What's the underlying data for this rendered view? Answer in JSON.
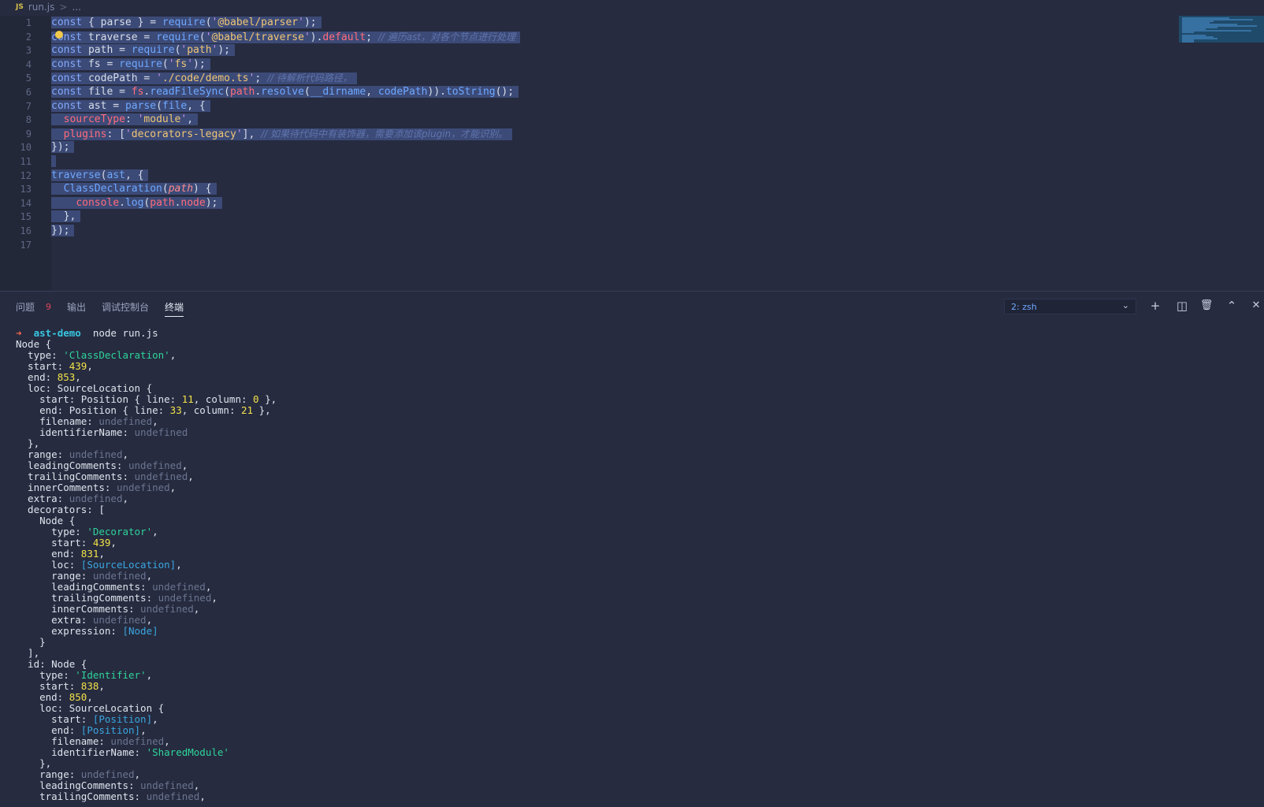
{
  "breadcrumb": {
    "badge": "JS",
    "file": "run.js",
    "sep": ">",
    "more": "..."
  },
  "editor": {
    "line_numbers": [
      "1",
      "2",
      "3",
      "4",
      "5",
      "6",
      "7",
      "8",
      "9",
      "10",
      "11",
      "12",
      "13",
      "14",
      "15",
      "16",
      "17"
    ],
    "lines": [
      [
        [
          "kw",
          "const "
        ],
        [
          "punc",
          "{ "
        ],
        [
          "id",
          "parse"
        ],
        [
          "punc",
          " } = "
        ],
        [
          "fn",
          "require"
        ],
        [
          "punc",
          "("
        ],
        [
          "strq",
          "'"
        ],
        [
          "str",
          "@babel/parser"
        ],
        [
          "strq",
          "'"
        ],
        [
          "punc",
          ");"
        ]
      ],
      [
        [
          "kw",
          "const "
        ],
        [
          "id",
          "traverse"
        ],
        [
          "punc",
          " = "
        ],
        [
          "fn",
          "require"
        ],
        [
          "punc",
          "("
        ],
        [
          "strq",
          "'"
        ],
        [
          "str",
          "@babel/traverse"
        ],
        [
          "strq",
          "'"
        ],
        [
          "punc",
          ")."
        ],
        [
          "prop",
          "default"
        ],
        [
          "punc",
          "; "
        ],
        [
          "cm",
          "// 遍历ast，对各个节点进行处理"
        ]
      ],
      [
        [
          "kw",
          "const "
        ],
        [
          "id",
          "path"
        ],
        [
          "punc",
          " = "
        ],
        [
          "fn",
          "require"
        ],
        [
          "punc",
          "("
        ],
        [
          "strq",
          "'"
        ],
        [
          "str",
          "path"
        ],
        [
          "strq",
          "'"
        ],
        [
          "punc",
          ");"
        ]
      ],
      [
        [
          "kw",
          "const "
        ],
        [
          "id",
          "fs"
        ],
        [
          "punc",
          " = "
        ],
        [
          "fn",
          "require"
        ],
        [
          "punc",
          "("
        ],
        [
          "strq",
          "'"
        ],
        [
          "str",
          "fs"
        ],
        [
          "strq",
          "'"
        ],
        [
          "punc",
          ");"
        ]
      ],
      [
        [
          "kw",
          "const "
        ],
        [
          "id",
          "codePath"
        ],
        [
          "punc",
          " = "
        ],
        [
          "strq",
          "'"
        ],
        [
          "str",
          "./code/demo.ts"
        ],
        [
          "strq",
          "'"
        ],
        [
          "punc",
          "; "
        ],
        [
          "cm",
          "// 待解析代码路径，"
        ]
      ],
      [
        [
          "kw",
          "const "
        ],
        [
          "id",
          "file"
        ],
        [
          "punc",
          " = "
        ],
        [
          "var",
          "fs"
        ],
        [
          "punc",
          "."
        ],
        [
          "fn",
          "readFileSync"
        ],
        [
          "punc",
          "("
        ],
        [
          "var",
          "path"
        ],
        [
          "punc",
          "."
        ],
        [
          "fn",
          "resolve"
        ],
        [
          "punc",
          "("
        ],
        [
          "fn",
          "__dirname"
        ],
        [
          "punc",
          ", "
        ],
        [
          "fn",
          "codePath"
        ],
        [
          "punc",
          "))."
        ],
        [
          "fn",
          "toString"
        ],
        [
          "punc",
          "();"
        ]
      ],
      [
        [
          "kw",
          "const "
        ],
        [
          "id",
          "ast"
        ],
        [
          "punc",
          " = "
        ],
        [
          "fn",
          "parse"
        ],
        [
          "punc",
          "("
        ],
        [
          "fn",
          "file"
        ],
        [
          "punc",
          ", {"
        ]
      ],
      [
        [
          "punc",
          "  "
        ],
        [
          "prop",
          "sourceType"
        ],
        [
          "punc",
          ": "
        ],
        [
          "strq",
          "'"
        ],
        [
          "str",
          "module"
        ],
        [
          "strq",
          "'"
        ],
        [
          "punc",
          ","
        ]
      ],
      [
        [
          "punc",
          "  "
        ],
        [
          "prop",
          "plugins"
        ],
        [
          "punc",
          ": ["
        ],
        [
          "strq",
          "'"
        ],
        [
          "str",
          "decorators-legacy"
        ],
        [
          "strq",
          "'"
        ],
        [
          "punc",
          "], "
        ],
        [
          "cm",
          "// 如果待代码中有装饰器，需要添加该plugin，才能识别。"
        ]
      ],
      [
        [
          "punc",
          "});"
        ]
      ],
      [
        [
          "punc",
          ""
        ]
      ],
      [
        [
          "fn",
          "traverse"
        ],
        [
          "punc",
          "("
        ],
        [
          "fn",
          "ast"
        ],
        [
          "punc",
          ", {"
        ]
      ],
      [
        [
          "punc",
          "  "
        ],
        [
          "fn",
          "ClassDeclaration"
        ],
        [
          "punc",
          "("
        ],
        [
          "param",
          "path"
        ],
        [
          "punc",
          ") {"
        ]
      ],
      [
        [
          "punc",
          "    "
        ],
        [
          "var",
          "console"
        ],
        [
          "punc",
          "."
        ],
        [
          "fn",
          "log"
        ],
        [
          "punc",
          "("
        ],
        [
          "var",
          "path"
        ],
        [
          "punc",
          "."
        ],
        [
          "var",
          "node"
        ],
        [
          "punc",
          ");"
        ]
      ],
      [
        [
          "punc",
          "  },"
        ]
      ],
      [
        [
          "punc",
          "});"
        ]
      ],
      []
    ]
  },
  "panel": {
    "tabs": [
      {
        "label": "问题",
        "badge": "9"
      },
      {
        "label": "输出"
      },
      {
        "label": "调试控制台"
      },
      {
        "label": "终端",
        "active": true
      }
    ],
    "terminal_select": "2: zsh",
    "actions": {
      "add": "+",
      "split": "◫",
      "trash": "🗑",
      "maximize": "⌃",
      "close": "✕"
    }
  },
  "terminal": {
    "lines": [
      [
        [
          "t-prompt-arrow",
          "➜ "
        ],
        [
          "t-dir",
          " ast-demo"
        ],
        [
          "",
          "  node run.js"
        ]
      ],
      [
        [
          "",
          "Node {"
        ]
      ],
      [
        [
          "",
          "  type: "
        ],
        [
          "t-str",
          "'ClassDeclaration'"
        ],
        [
          "",
          ","
        ]
      ],
      [
        [
          "",
          "  start: "
        ],
        [
          "t-num",
          "439"
        ],
        [
          "",
          ","
        ]
      ],
      [
        [
          "",
          "  end: "
        ],
        [
          "t-num",
          "853"
        ],
        [
          "",
          ","
        ]
      ],
      [
        [
          "",
          "  loc: SourceLocation {"
        ]
      ],
      [
        [
          "",
          "    start: Position { line: "
        ],
        [
          "t-num",
          "11"
        ],
        [
          "",
          ", column: "
        ],
        [
          "t-num",
          "0"
        ],
        [
          "",
          " },"
        ]
      ],
      [
        [
          "",
          "    end: Position { line: "
        ],
        [
          "t-num",
          "33"
        ],
        [
          "",
          ", column: "
        ],
        [
          "t-num",
          "21"
        ],
        [
          "",
          " },"
        ]
      ],
      [
        [
          "",
          "    filename: "
        ],
        [
          "t-undef",
          "undefined"
        ],
        [
          "",
          ","
        ]
      ],
      [
        [
          "",
          "    identifierName: "
        ],
        [
          "t-undef",
          "undefined"
        ]
      ],
      [
        [
          "",
          "  },"
        ]
      ],
      [
        [
          "",
          "  range: "
        ],
        [
          "t-undef",
          "undefined"
        ],
        [
          "",
          ","
        ]
      ],
      [
        [
          "",
          "  leadingComments: "
        ],
        [
          "t-undef",
          "undefined"
        ],
        [
          "",
          ","
        ]
      ],
      [
        [
          "",
          "  trailingComments: "
        ],
        [
          "t-undef",
          "undefined"
        ],
        [
          "",
          ","
        ]
      ],
      [
        [
          "",
          "  innerComments: "
        ],
        [
          "t-undef",
          "undefined"
        ],
        [
          "",
          ","
        ]
      ],
      [
        [
          "",
          "  extra: "
        ],
        [
          "t-undef",
          "undefined"
        ],
        [
          "",
          ","
        ]
      ],
      [
        [
          "",
          "  decorators: ["
        ]
      ],
      [
        [
          "",
          "    Node {"
        ]
      ],
      [
        [
          "",
          "      type: "
        ],
        [
          "t-str",
          "'Decorator'"
        ],
        [
          "",
          ","
        ]
      ],
      [
        [
          "",
          "      start: "
        ],
        [
          "t-num",
          "439"
        ],
        [
          "",
          ","
        ]
      ],
      [
        [
          "",
          "      end: "
        ],
        [
          "t-num",
          "831"
        ],
        [
          "",
          ","
        ]
      ],
      [
        [
          "",
          "      loc: "
        ],
        [
          "t-ref",
          "[SourceLocation]"
        ],
        [
          "",
          ","
        ]
      ],
      [
        [
          "",
          "      range: "
        ],
        [
          "t-undef",
          "undefined"
        ],
        [
          "",
          ","
        ]
      ],
      [
        [
          "",
          "      leadingComments: "
        ],
        [
          "t-undef",
          "undefined"
        ],
        [
          "",
          ","
        ]
      ],
      [
        [
          "",
          "      trailingComments: "
        ],
        [
          "t-undef",
          "undefined"
        ],
        [
          "",
          ","
        ]
      ],
      [
        [
          "",
          "      innerComments: "
        ],
        [
          "t-undef",
          "undefined"
        ],
        [
          "",
          ","
        ]
      ],
      [
        [
          "",
          "      extra: "
        ],
        [
          "t-undef",
          "undefined"
        ],
        [
          "",
          ","
        ]
      ],
      [
        [
          "",
          "      expression: "
        ],
        [
          "t-ref",
          "[Node]"
        ]
      ],
      [
        [
          "",
          "    }"
        ]
      ],
      [
        [
          "",
          "  ],"
        ]
      ],
      [
        [
          "",
          "  id: Node {"
        ]
      ],
      [
        [
          "",
          "    type: "
        ],
        [
          "t-str",
          "'Identifier'"
        ],
        [
          "",
          ","
        ]
      ],
      [
        [
          "",
          "    start: "
        ],
        [
          "t-num",
          "838"
        ],
        [
          "",
          ","
        ]
      ],
      [
        [
          "",
          "    end: "
        ],
        [
          "t-num",
          "850"
        ],
        [
          "",
          ","
        ]
      ],
      [
        [
          "",
          "    loc: SourceLocation {"
        ]
      ],
      [
        [
          "",
          "      start: "
        ],
        [
          "t-ref",
          "[Position]"
        ],
        [
          "",
          ","
        ]
      ],
      [
        [
          "",
          "      end: "
        ],
        [
          "t-ref",
          "[Position]"
        ],
        [
          "",
          ","
        ]
      ],
      [
        [
          "",
          "      filename: "
        ],
        [
          "t-undef",
          "undefined"
        ],
        [
          "",
          ","
        ]
      ],
      [
        [
          "",
          "      identifierName: "
        ],
        [
          "t-str",
          "'SharedModule'"
        ]
      ],
      [
        [
          "",
          "    },"
        ]
      ],
      [
        [
          "",
          "    range: "
        ],
        [
          "t-undef",
          "undefined"
        ],
        [
          "",
          ","
        ]
      ],
      [
        [
          "",
          "    leadingComments: "
        ],
        [
          "t-undef",
          "undefined"
        ],
        [
          "",
          ","
        ]
      ],
      [
        [
          "",
          "    trailingComments: "
        ],
        [
          "t-undef",
          "undefined"
        ],
        [
          "",
          ","
        ]
      ]
    ]
  }
}
